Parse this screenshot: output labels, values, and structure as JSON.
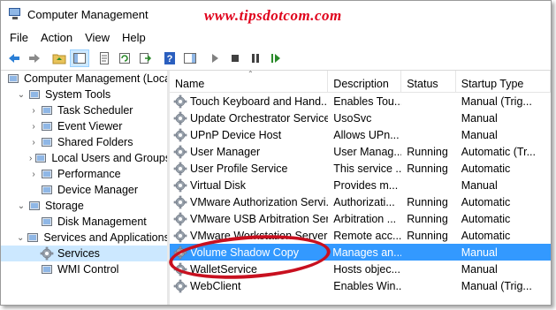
{
  "window": {
    "title": "Computer Management"
  },
  "watermark": "www.tipsdotcom.com",
  "menu": [
    "File",
    "Action",
    "View",
    "Help"
  ],
  "toolbar": [
    "back-icon",
    "forward-icon",
    "up-folder-icon",
    "show-hide-tree-icon",
    "properties-icon",
    "refresh-icon",
    "export-list-icon",
    "help-icon",
    "action-pane-icon",
    "start-service-icon",
    "stop-service-icon",
    "pause-service-icon",
    "restart-service-icon"
  ],
  "tree": [
    {
      "label": "Computer Management (Local",
      "level": 0,
      "expander": "",
      "icon": "computer-icon"
    },
    {
      "label": "System Tools",
      "level": 1,
      "expander": "⌄",
      "icon": "tools-icon"
    },
    {
      "label": "Task Scheduler",
      "level": 2,
      "expander": "›",
      "icon": "clock-icon"
    },
    {
      "label": "Event Viewer",
      "level": 2,
      "expander": "›",
      "icon": "event-viewer-icon"
    },
    {
      "label": "Shared Folders",
      "level": 2,
      "expander": "›",
      "icon": "shared-folder-icon"
    },
    {
      "label": "Local Users and Groups",
      "level": 2,
      "expander": "›",
      "icon": "users-icon"
    },
    {
      "label": "Performance",
      "level": 2,
      "expander": "›",
      "icon": "performance-icon"
    },
    {
      "label": "Device Manager",
      "level": 2,
      "expander": "",
      "icon": "device-manager-icon"
    },
    {
      "label": "Storage",
      "level": 1,
      "expander": "⌄",
      "icon": "storage-icon"
    },
    {
      "label": "Disk Management",
      "level": 2,
      "expander": "",
      "icon": "disk-icon"
    },
    {
      "label": "Services and Applications",
      "level": 1,
      "expander": "⌄",
      "icon": "services-apps-icon"
    },
    {
      "label": "Services",
      "level": 2,
      "expander": "",
      "icon": "gear-icon",
      "selected": true
    },
    {
      "label": "WMI Control",
      "level": 2,
      "expander": "",
      "icon": "wmi-icon"
    }
  ],
  "columns": [
    "Name",
    "Description",
    "Status",
    "Startup Type"
  ],
  "services": [
    {
      "name": "Touch Keyboard and Hand...",
      "desc": "Enables Tou...",
      "status": "",
      "startup": "Manual (Trig..."
    },
    {
      "name": "Update Orchestrator Service",
      "desc": "UsoSvc",
      "status": "",
      "startup": "Manual"
    },
    {
      "name": "UPnP Device Host",
      "desc": "Allows UPn...",
      "status": "",
      "startup": "Manual"
    },
    {
      "name": "User Manager",
      "desc": "User Manag...",
      "status": "Running",
      "startup": "Automatic (Tr..."
    },
    {
      "name": "User Profile Service",
      "desc": "This service ...",
      "status": "Running",
      "startup": "Automatic"
    },
    {
      "name": "Virtual Disk",
      "desc": "Provides m...",
      "status": "",
      "startup": "Manual"
    },
    {
      "name": "VMware Authorization Servi...",
      "desc": "Authorizati...",
      "status": "Running",
      "startup": "Automatic"
    },
    {
      "name": "VMware USB Arbitration Ser...",
      "desc": "Arbitration ...",
      "status": "Running",
      "startup": "Automatic"
    },
    {
      "name": "VMware Workstation Server",
      "desc": "Remote acc...",
      "status": "Running",
      "startup": "Automatic"
    },
    {
      "name": "Volume Shadow Copy",
      "desc": "Manages an...",
      "status": "",
      "startup": "Manual",
      "selected": true
    },
    {
      "name": "WalletService",
      "desc": "Hosts objec...",
      "status": "",
      "startup": "Manual"
    },
    {
      "name": "WebClient",
      "desc": "Enables Win...",
      "status": "",
      "startup": "Manual (Trig..."
    }
  ],
  "colors": {
    "selection": "#3399ff",
    "tree_selection": "#cce8ff",
    "highlight_circle": "#c8101f",
    "watermark": "#e0001b"
  }
}
